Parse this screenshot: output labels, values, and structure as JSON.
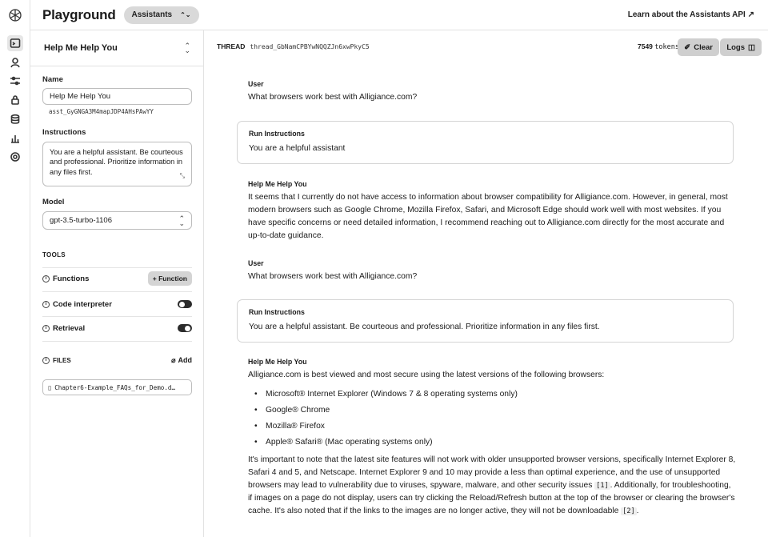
{
  "header": {
    "title": "Playground",
    "mode": "Assistants",
    "learn_link": "Learn about the Assistants API ↗"
  },
  "rail": {
    "icons": [
      "openai-logo",
      "playground-icon",
      "assistants-icon",
      "fine-tuning-icon",
      "api-keys-icon",
      "storage-icon",
      "usage-icon",
      "settings-icon"
    ]
  },
  "assistant": {
    "selected_name": "Help Me Help You",
    "name_label": "Name",
    "name_value": "Help Me Help You",
    "id": "asst_GyGNGA3M4mapJDP4AHsPAwYY",
    "instructions_label": "Instructions",
    "instructions_value": "You are a helpful assistant. Be courteous and professional. Prioritize information in any files first.",
    "model_label": "Model",
    "model_value": "gpt-3.5-turbo-1106",
    "tools_heading": "TOOLS",
    "tools": {
      "functions_label": "Functions",
      "function_button": "+ Function",
      "code_label": "Code interpreter",
      "code_enabled": false,
      "retrieval_label": "Retrieval",
      "retrieval_enabled": true
    },
    "files_heading": "FILES",
    "add_label": "Add",
    "file_name": "Chapter6-Example_FAQs_for_Demo.d…"
  },
  "thread": {
    "label": "THREAD",
    "id": "thread_GbNamCPBYwNQQZJn6xwPkyC5",
    "tokens_count": "7549",
    "tokens_unit": "tokens",
    "clear_label": "Clear",
    "logs_label": "Logs"
  },
  "messages": [
    {
      "role": "User",
      "text": "What browsers work best with Alligiance.com?"
    },
    {
      "role": "Run Instructions",
      "text": "You are a helpful assistant"
    },
    {
      "role": "Help Me Help You",
      "text": "It seems that I currently do not have access to information about browser compatibility for Alligiance.com. However, in general, most modern browsers such as Google Chrome, Mozilla Firefox, Safari, and Microsoft Edge should work well with most websites. If you have specific concerns or need detailed information, I recommend reaching out to Alligiance.com directly for the most accurate and up-to-date guidance."
    },
    {
      "role": "User",
      "text": "What browsers work best with Alligiance.com?"
    },
    {
      "role": "Run Instructions",
      "text": "You are a helpful assistant. Be courteous and professional. Prioritize information in any files first."
    },
    {
      "role": "Help Me Help You",
      "intro": "Alligiance.com is best viewed and most secure using the latest versions of the following browsers:",
      "bullets": [
        "Microsoft® Internet Explorer (Windows 7 & 8 operating systems only)",
        "Google® Chrome",
        "Mozilla® Firefox",
        "Apple® Safari® (Mac operating systems only)"
      ],
      "para_a": "It's important to note that the latest site features will not work with older unsupported browser versions, specifically Internet Explorer 8, Safari 4 and 5, and Netscape. Internet Explorer 9 and 10 may provide a less than optimal experience, and the use of unsupported browsers may lead to vulnerability due to viruses, spyware, malware, and other security issues",
      "cite_1": "[1]",
      "para_b": ". Additionally, for troubleshooting, if images on a page do not display, users can try clicking the Reload/Refresh button at the top of the browser or clearing the browser's cache. It's also noted that if the links to the images are no longer active, they will not be downloadable",
      "cite_2": "[2]",
      "para_end": "."
    }
  ]
}
